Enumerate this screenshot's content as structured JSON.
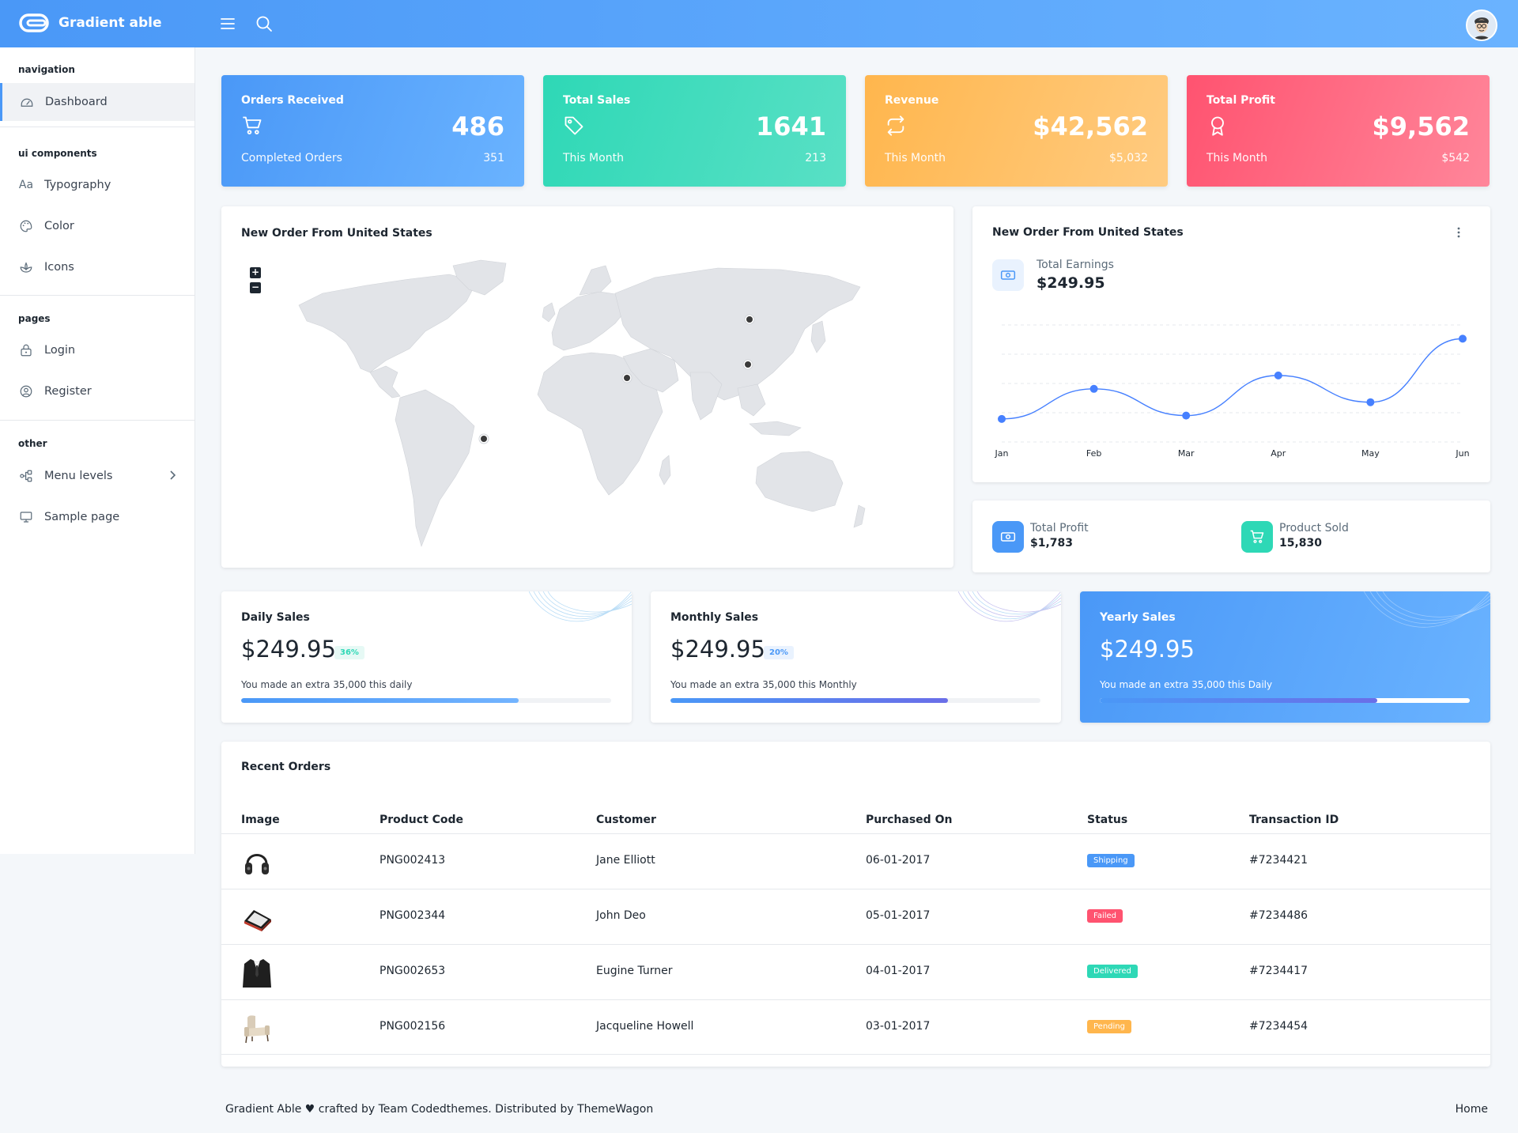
{
  "app": {
    "brand": "Gradient able"
  },
  "header": {
    "menu_icon": "hamburger-icon",
    "search_icon": "search-icon",
    "avatar_icon": "user-avatar"
  },
  "sidebar": {
    "sections": [
      {
        "caption": "navigation",
        "items": [
          {
            "label": "Dashboard",
            "icon": "dashboard-icon",
            "active": true
          }
        ]
      },
      {
        "caption": "ui components",
        "items": [
          {
            "label": "Typography",
            "icon": "typography-icon"
          },
          {
            "label": "Color",
            "icon": "palette-icon"
          },
          {
            "label": "Icons",
            "icon": "plant-icon"
          }
        ]
      },
      {
        "caption": "pages",
        "items": [
          {
            "label": "Login",
            "icon": "lock-icon"
          },
          {
            "label": "Register",
            "icon": "user-circle-icon"
          }
        ]
      },
      {
        "caption": "other",
        "items": [
          {
            "label": "Menu levels",
            "icon": "menu-tree-icon"
          },
          {
            "label": "Sample page",
            "icon": "desktop-icon"
          }
        ]
      }
    ]
  },
  "stats": [
    {
      "title": "Orders Received",
      "value": "486",
      "sub_label": "Completed Orders",
      "sub_value": "351",
      "icon": "cart-icon",
      "gradient": [
        "#4a98f7",
        "#6ab3ff"
      ]
    },
    {
      "title": "Total Sales",
      "value": "1641",
      "sub_label": "This Month",
      "sub_value": "213",
      "icon": "tag-icon",
      "gradient": [
        "#2ed8b6",
        "#59e0c5"
      ]
    },
    {
      "title": "Revenue",
      "value": "$42,562",
      "sub_label": "This Month",
      "sub_value": "$5,032",
      "icon": "repeat-icon",
      "gradient": [
        "#ffb64d",
        "#ffcb80"
      ]
    },
    {
      "title": "Total Profit",
      "value": "$9,562",
      "sub_label": "This Month",
      "sub_value": "$542",
      "icon": "award-icon",
      "gradient": [
        "#ff5370",
        "#ff869a"
      ]
    }
  ],
  "map_card": {
    "title": "New Order From United States",
    "zoom_in": "+",
    "zoom_out": "−"
  },
  "earnings_card": {
    "title": "New Order From United States",
    "label": "Total Earnings",
    "value": "$249.95",
    "chart_data": {
      "type": "line",
      "categories": [
        "Jan",
        "Feb",
        "Mar",
        "Apr",
        "May",
        "Jun"
      ],
      "series": [
        {
          "values": [
            10,
            28,
            12,
            36,
            20,
            58
          ]
        }
      ],
      "ylim": [
        0,
        70
      ],
      "grid": true,
      "color": "#4680ff"
    }
  },
  "mini_stats": [
    {
      "label": "Total Profit",
      "value": "$1,783",
      "icon": "money-icon",
      "color": "#4a98f7"
    },
    {
      "label": "Product Sold",
      "value": "15,830",
      "icon": "cart-icon",
      "color": "#2ed8b6"
    }
  ],
  "sales": [
    {
      "title": "Daily Sales",
      "value": "$249.95",
      "badge": "36%",
      "desc": "You made an extra 35,000 this daily",
      "progress": 0.75,
      "badge_bg": "#e6f9f5",
      "badge_fg": "#2ed8b6"
    },
    {
      "title": "Monthly Sales",
      "value": "$249.95",
      "badge": "20%",
      "desc": "You made an extra 35,000 this Monthly",
      "progress": 0.75,
      "badge_bg": "#e9f2fe",
      "badge_fg": "#4a98f7"
    },
    {
      "title": "Yearly Sales",
      "value": "$249.95",
      "desc": "You made an extra 35,000 this Daily",
      "progress": 0.75
    }
  ],
  "orders": {
    "title": "Recent Orders",
    "columns": [
      "Image",
      "Product Code",
      "Customer",
      "Purchased On",
      "Status",
      "Transaction ID"
    ],
    "rows": [
      {
        "image": "headphones-image",
        "code": "PNG002413",
        "customer": "Jane Elliott",
        "date": "06-01-2017",
        "status": "Shipping",
        "status_color": "#4a98f7",
        "txn": "#7234421"
      },
      {
        "image": "phone-image",
        "code": "PNG002344",
        "customer": "John Deo",
        "date": "05-01-2017",
        "status": "Failed",
        "status_color": "#ff5370",
        "txn": "#7234486"
      },
      {
        "image": "suit-image",
        "code": "PNG002653",
        "customer": "Eugine Turner",
        "date": "04-01-2017",
        "status": "Delivered",
        "status_color": "#2ed8b6",
        "txn": "#7234417"
      },
      {
        "image": "chair-image",
        "code": "PNG002156",
        "customer": "Jacqueline Howell",
        "date": "03-01-2017",
        "status": "Pending",
        "status_color": "#ffb64d",
        "txn": "#7234454"
      }
    ]
  },
  "footer": {
    "credit": "Gradient Able ♥ crafted by Team Codedthemes. Distributed by ThemeWagon",
    "home": "Home"
  }
}
